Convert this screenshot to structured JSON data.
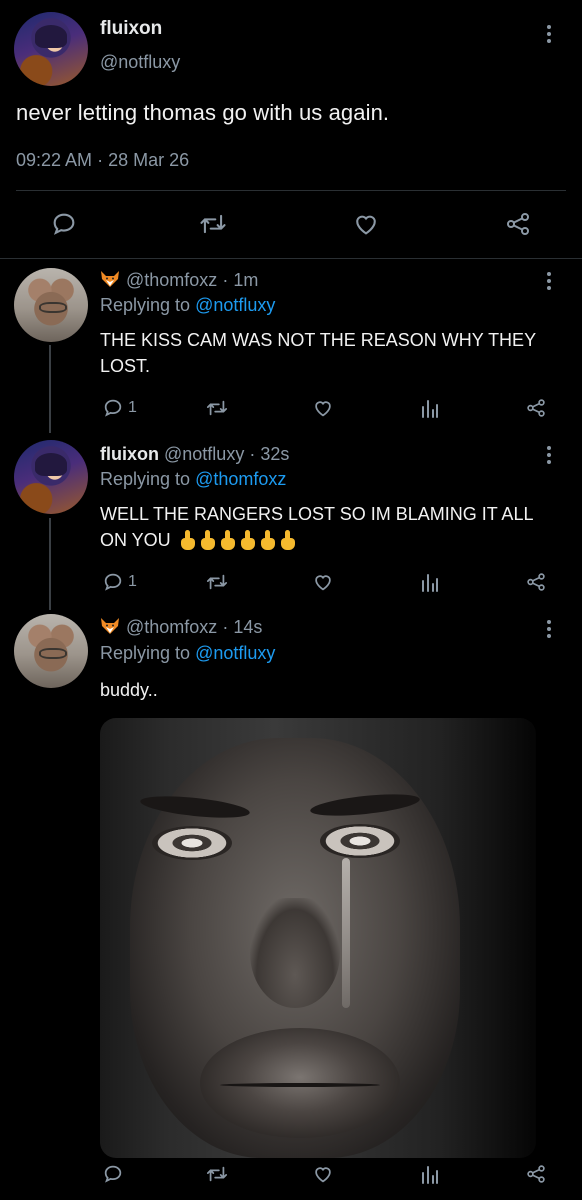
{
  "main_tweet": {
    "display_name": "fluixon",
    "handle": "@notfluxy",
    "text": "never letting thomas go with us again.",
    "time": "09:22 AM",
    "separator": "·",
    "date": "28 Mar 26",
    "actions": [
      "reply-icon",
      "retweet-icon",
      "like-icon",
      "share-icon"
    ]
  },
  "replies": [
    {
      "display_name": "",
      "handle": "@thomfoxz",
      "separator": "·",
      "time": "1m",
      "replying_prefix": "Replying to",
      "replying_to": "@notfluxy",
      "text": "THE KISS CAM WAS NOT THE REASON WHY THEY LOST.",
      "reply_count": "1",
      "avatar_icon": "fox-emoji-icon"
    },
    {
      "display_name": "fluixon",
      "handle": "@notfluxy",
      "separator": "·",
      "time": "32s",
      "replying_prefix": "Replying to",
      "replying_to": "@thomfoxz",
      "text": "WELL THE RANGERS LOST SO IM BLAMING IT ALL ON YOU",
      "emoji": "middle-finger-emoji x6",
      "reply_count": "1"
    },
    {
      "display_name": "",
      "handle": "@thomfoxz",
      "separator": "·",
      "time": "14s",
      "replying_prefix": "Replying to",
      "replying_to": "@notfluxy",
      "text": "buddy..",
      "media": "crying-face-photo",
      "reply_count": ""
    }
  ],
  "colors": {
    "background": "#000000",
    "text": "#e7e9ea",
    "secondary": "#8b98a5",
    "link": "#1d9bf0",
    "divider": "#2a2f33"
  }
}
